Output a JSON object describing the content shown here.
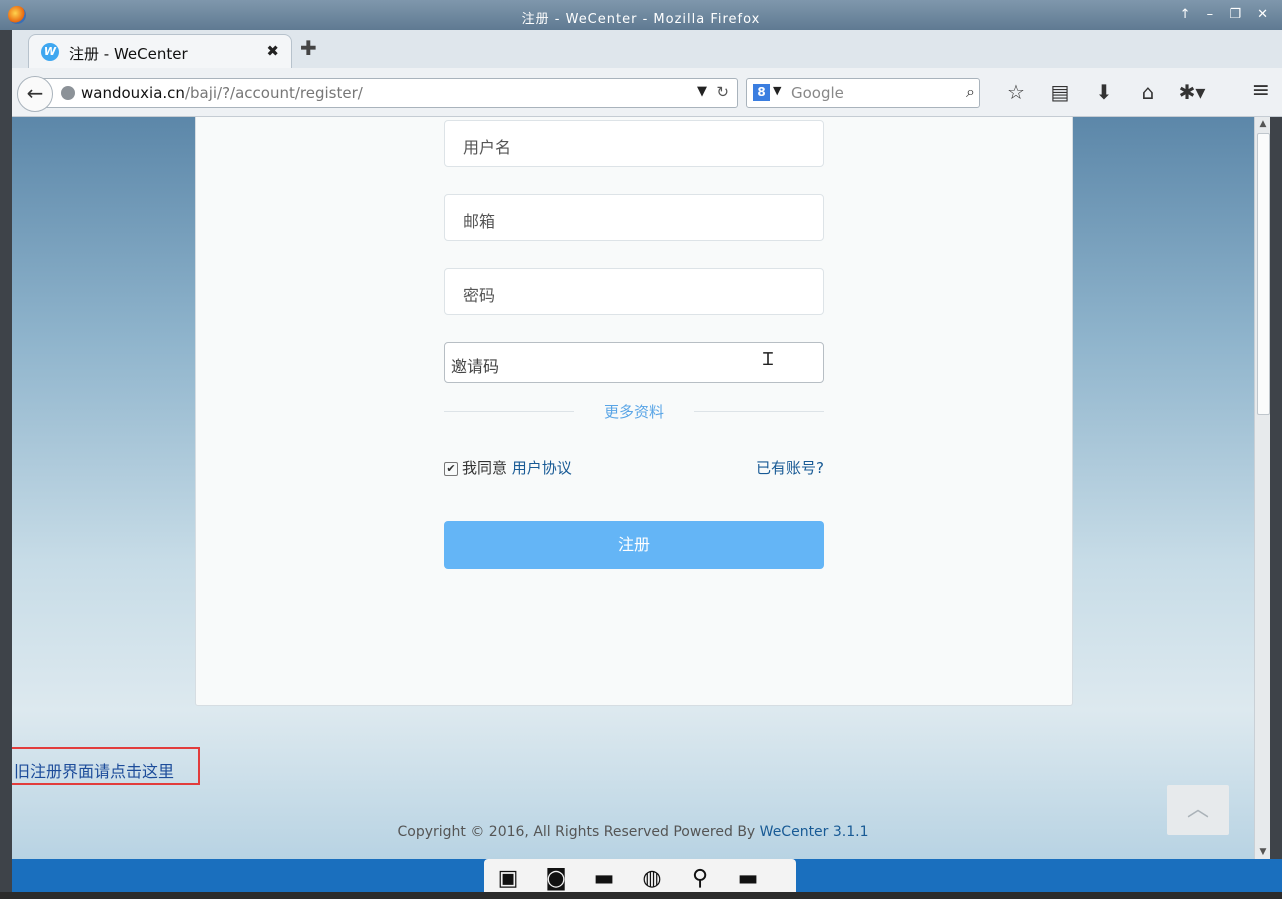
{
  "window": {
    "title": "注册 - WeCenter - Mozilla Firefox",
    "controls": "↑ – ❐ ✕"
  },
  "tab": {
    "label": "注册 - WeCenter",
    "close": "✖",
    "new_tab": "✚",
    "favicon": "W"
  },
  "nav": {
    "url_host": "wandouxia.cn",
    "url_path": "/baji/?/account/register/",
    "search_placeholder": "Google",
    "search_engine_letter": "8",
    "icons": [
      "binoculars-icon",
      "star-icon",
      "reading-list-icon",
      "download-icon",
      "home-icon",
      "extension-icon",
      "menu-icon"
    ]
  },
  "form": {
    "username_placeholder": "用户名",
    "email_placeholder": "邮箱",
    "password_placeholder": "密码",
    "invite_placeholder": "邀请码",
    "more_info": "更多资料",
    "agree_text": "我同意",
    "agreement_link": "用户协议",
    "have_account_link": "已有账号?",
    "submit_label": "注册",
    "agree_checked": true
  },
  "old_register_link": "旧注册界面请点击这里",
  "footer": {
    "copyright": "Copyright © 2016, All Rights Reserved Powered By",
    "brand_link": "WeCenter 3.1.1"
  },
  "colors": {
    "accent": "#64b5f6",
    "link": "#185a95",
    "highlight_box": "#e23c3c",
    "taskbar": "#1a6fbe"
  }
}
